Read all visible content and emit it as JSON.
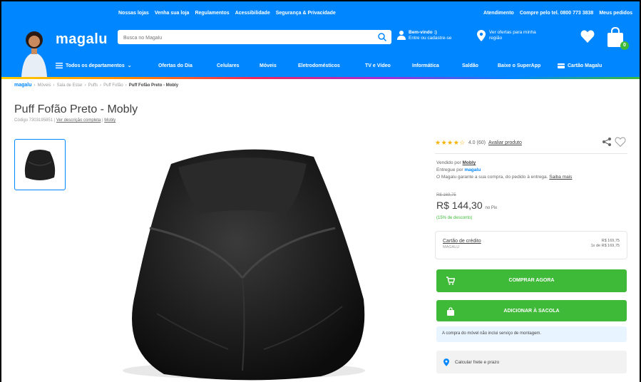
{
  "topbar": {
    "links": [
      "Nossas lojas",
      "Venha sua loja",
      "Regulamentos",
      "Acessibilidade",
      "Segurança & Privacidade"
    ],
    "right": [
      "Atendimento",
      "Compre pelo tel. 0800 773 3838",
      "Meus pedidos"
    ]
  },
  "header": {
    "logo": "magalu",
    "search_placeholder": "Busca no Magalu",
    "login_line1": "Bem-vindo :)",
    "login_line2": "Entre ou cadastre-se",
    "location_line1": "Ver ofertas para minha",
    "location_line2": "região",
    "cart_count": "0"
  },
  "nav": {
    "items": [
      "Todos os departamentos",
      "Ofertas do Dia",
      "Celulares",
      "Móveis",
      "Eletrodomésticos",
      "TV e Vídeo",
      "Informática",
      "Saldão",
      "Baixe o SuperApp",
      "Cartão Magalu"
    ]
  },
  "breadcrumb": {
    "home": "magalu",
    "items": [
      "Móveis",
      "Sala de Estar",
      "Puffs",
      "Puff Fofão",
      "Puff Fofão Preto - Mobly"
    ]
  },
  "product": {
    "title": "Puff Fofão Preto - Mobly",
    "code": "Código 7303195851",
    "desc_link": "Ver descrição completa",
    "brand": "Mobly",
    "rating_stars": "★★★★☆",
    "rating_text": "4.0 (60)",
    "rating_link": "Avaliar produto",
    "sold_by_label": "Vendido por",
    "sold_by": "Mobly",
    "delivered_by_label": "Entregue por",
    "delivered_by": "magalu",
    "guarantee": "O Magalu garante a sua compra, do pedido à entrega.",
    "guarantee_link": "Saiba mais",
    "old_price": "R$ 169,75",
    "price": "R$ 144,30",
    "price_suffix": "no Pix",
    "discount": "(15% de desconto)",
    "card_label": "Cartão de crédito",
    "card_sub": "MAGALU",
    "card_value1": "R$ 169,75",
    "card_value2": "1x de R$ 169,75",
    "buy_now": "COMPRAR AGORA",
    "add_bag": "ADICIONAR À SACOLA",
    "notice": "A compra do móvel não inclui serviço de montagem.",
    "freight": "Calcular frete e prazo"
  },
  "colors": {
    "brand_blue": "#0086ff",
    "buy_green": "#3fba38",
    "star": "#f5b301"
  }
}
